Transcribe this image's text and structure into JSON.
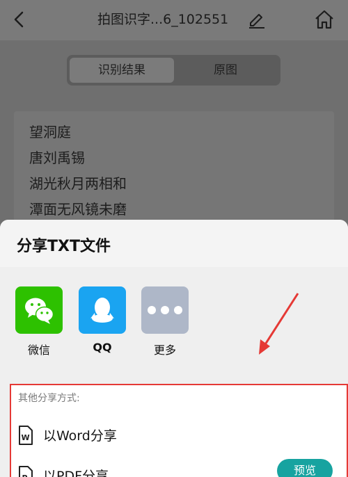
{
  "header": {
    "title": "拍图识字...6_102551"
  },
  "tabs": [
    {
      "label": "识别结果",
      "active": true
    },
    {
      "label": "原图",
      "active": false
    }
  ],
  "poem_lines": [
    "望洞庭",
    "唐刘禹锡",
    "湖光秋月两相和",
    "潭面无风镜未磨"
  ],
  "share_sheet": {
    "title": "分享TXT文件",
    "apps": [
      {
        "label": "微信",
        "icon": "wechat-icon",
        "color": "#2dc100"
      },
      {
        "label": "QQ",
        "icon": "qq-icon",
        "color": "#1aa4f1"
      },
      {
        "label": "更多",
        "icon": "more-icon",
        "color": "#aeb7c8"
      }
    ],
    "other_label": "其他分享方式:",
    "other_items": [
      {
        "label": "以Word分享",
        "icon": "word-doc-icon"
      },
      {
        "label": "以PDF分享",
        "icon": "pdf-doc-icon",
        "action": "预览"
      }
    ]
  },
  "colors": {
    "accent_teal": "#17a3a0",
    "highlight_red": "#e53935"
  }
}
